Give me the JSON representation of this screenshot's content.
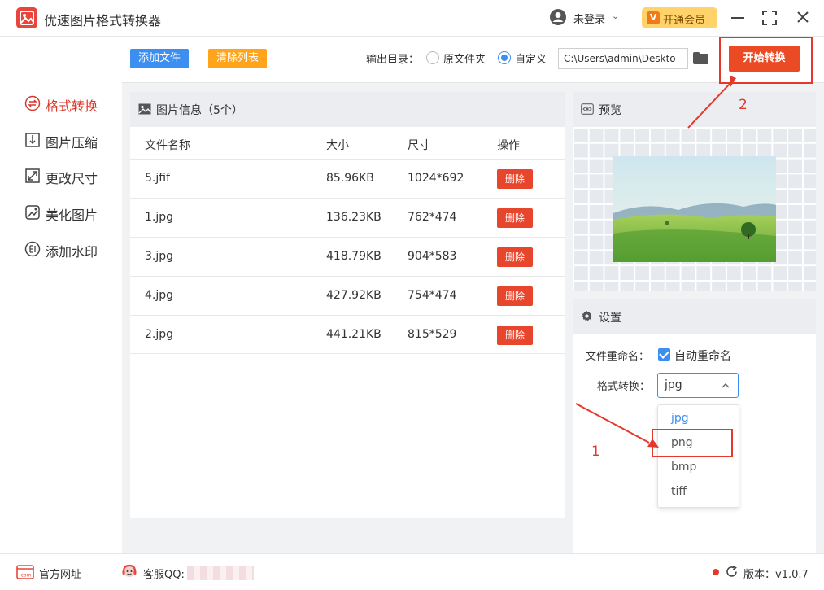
{
  "app": {
    "title": "优速图片格式转换器"
  },
  "header": {
    "login": "未登录",
    "vip": "开通会员"
  },
  "sidebar": {
    "items": [
      {
        "label": "格式转换",
        "active": true
      },
      {
        "label": "图片压缩"
      },
      {
        "label": "更改尺寸"
      },
      {
        "label": "美化图片"
      },
      {
        "label": "添加水印"
      }
    ]
  },
  "toolbar": {
    "add_files": "添加文件",
    "clear_list": "清除列表",
    "output_label": "输出目录：",
    "radio_original": "原文件夹",
    "radio_custom": "自定义",
    "path_value": "C:\\Users\\admin\\Deskto",
    "start": "开始转换"
  },
  "file_panel": {
    "title": "图片信息（5个）",
    "columns": [
      "文件名称",
      "大小",
      "尺寸",
      "操作"
    ],
    "rows": [
      {
        "name": "5.jfif",
        "size": "85.96KB",
        "dims": "1024*692",
        "action": "删除"
      },
      {
        "name": "1.jpg",
        "size": "136.23KB",
        "dims": "762*474",
        "action": "删除"
      },
      {
        "name": "3.jpg",
        "size": "418.79KB",
        "dims": "904*583",
        "action": "删除"
      },
      {
        "name": "4.jpg",
        "size": "427.92KB",
        "dims": "754*474",
        "action": "删除"
      },
      {
        "name": "2.jpg",
        "size": "441.21KB",
        "dims": "815*529",
        "action": "删除"
      }
    ]
  },
  "preview": {
    "title": "预览"
  },
  "settings": {
    "title": "设置",
    "rename_label": "文件重命名：",
    "rename_option": "自动重命名",
    "format_label": "格式转换：",
    "format_value": "jpg",
    "format_options": [
      "jpg",
      "png",
      "bmp",
      "tiff"
    ]
  },
  "annotations": {
    "step1": "1",
    "step2": "2",
    "color": "#e5372b"
  },
  "footer": {
    "site": "官方网址",
    "qq": "客服QQ:",
    "version": "版本：v1.0.7"
  },
  "colors": {
    "accent": "#3c8ef0",
    "danger": "#e8462c",
    "start": "#ea4b24",
    "clear": "#ffa41b"
  }
}
